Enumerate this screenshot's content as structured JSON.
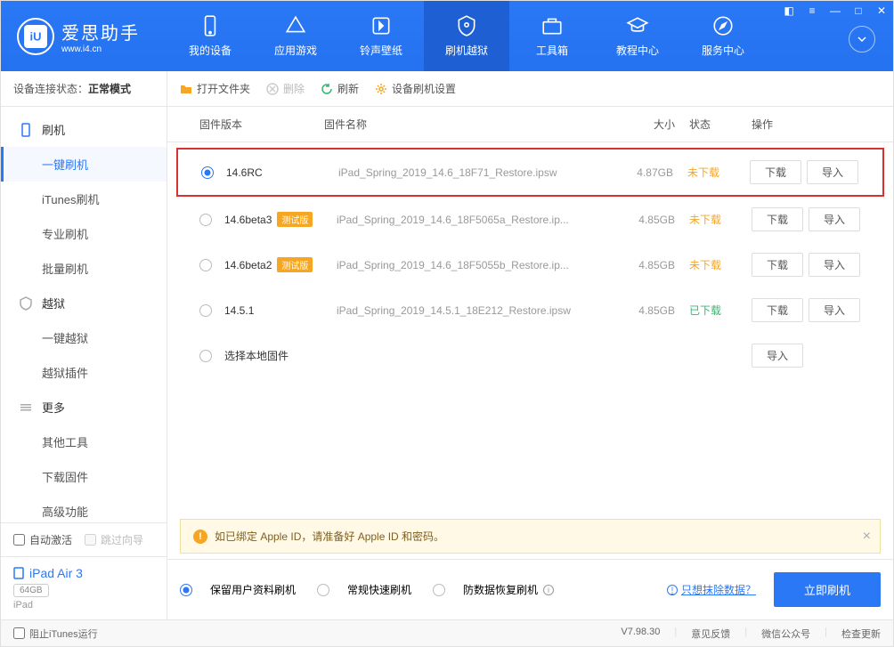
{
  "header": {
    "logo_title": "爱思助手",
    "logo_sub": "www.i4.cn",
    "nav": [
      {
        "label": "我的设备"
      },
      {
        "label": "应用游戏"
      },
      {
        "label": "铃声壁纸"
      },
      {
        "label": "刷机越狱"
      },
      {
        "label": "工具箱"
      },
      {
        "label": "教程中心"
      },
      {
        "label": "服务中心"
      }
    ]
  },
  "sidebar": {
    "status_label": "设备连接状态：",
    "status_value": "正常模式",
    "groups": [
      {
        "label": "刷机",
        "items": [
          "一键刷机",
          "iTunes刷机",
          "专业刷机",
          "批量刷机"
        ]
      },
      {
        "label": "越狱",
        "items": [
          "一键越狱",
          "越狱插件"
        ]
      },
      {
        "label": "更多",
        "items": [
          "其他工具",
          "下载固件",
          "高级功能"
        ]
      }
    ],
    "auto_activate": "自动激活",
    "skip_wizard": "跳过向导",
    "device_name": "iPad Air 3",
    "device_capacity": "64GB",
    "device_type": "iPad"
  },
  "toolbar": {
    "open_folder": "打开文件夹",
    "delete": "删除",
    "refresh": "刷新",
    "settings": "设备刷机设置"
  },
  "table": {
    "headers": {
      "version": "固件版本",
      "name": "固件名称",
      "size": "大小",
      "status": "状态",
      "action": "操作"
    },
    "buttons": {
      "download": "下载",
      "import": "导入"
    },
    "badge_beta": "测试版",
    "status_labels": {
      "not_downloaded": "未下载",
      "downloaded": "已下载"
    },
    "rows": [
      {
        "version": "14.6RC",
        "beta": false,
        "name": "iPad_Spring_2019_14.6_18F71_Restore.ipsw",
        "size": "4.87GB",
        "status": "not_downloaded",
        "selected": true,
        "highlight": true,
        "has_download": true
      },
      {
        "version": "14.6beta3",
        "beta": true,
        "name": "iPad_Spring_2019_14.6_18F5065a_Restore.ip...",
        "size": "4.85GB",
        "status": "not_downloaded",
        "selected": false,
        "has_download": true
      },
      {
        "version": "14.6beta2",
        "beta": true,
        "name": "iPad_Spring_2019_14.6_18F5055b_Restore.ip...",
        "size": "4.85GB",
        "status": "not_downloaded",
        "selected": false,
        "has_download": true
      },
      {
        "version": "14.5.1",
        "beta": false,
        "name": "iPad_Spring_2019_14.5.1_18E212_Restore.ipsw",
        "size": "4.85GB",
        "status": "downloaded",
        "selected": false,
        "has_download": true
      }
    ],
    "local_firmware": "选择本地固件"
  },
  "warning": "如已绑定 Apple ID，请准备好 Apple ID 和密码。",
  "flash_options": {
    "opt1": "保留用户资料刷机",
    "opt2": "常规快速刷机",
    "opt3": "防数据恢复刷机",
    "erase_link": "只想抹除数据？",
    "flash_btn": "立即刷机"
  },
  "footer": {
    "block_itunes": "阻止iTunes运行",
    "version": "V7.98.30",
    "feedback": "意见反馈",
    "wechat": "微信公众号",
    "check_update": "检查更新"
  }
}
